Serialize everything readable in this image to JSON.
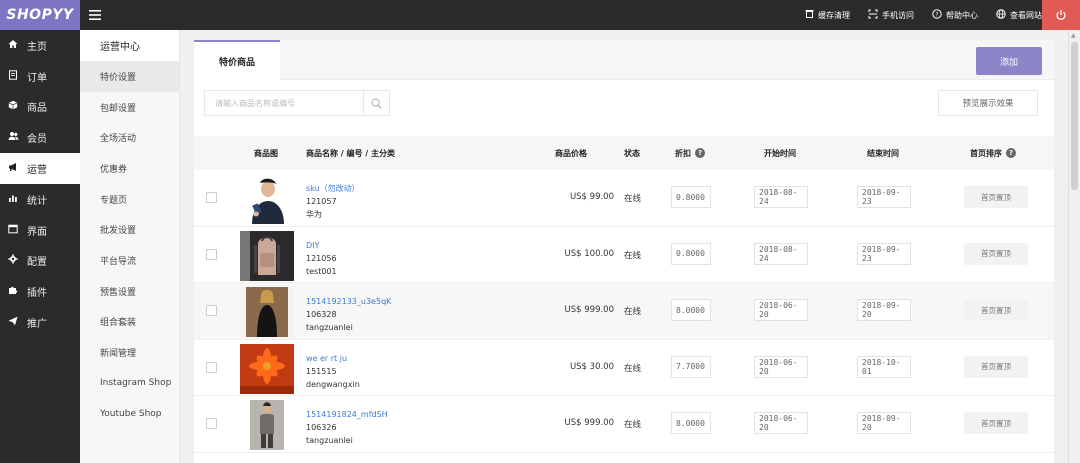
{
  "app": {
    "logo": "SHOPYY"
  },
  "topbar": {
    "actions": [
      {
        "label": "缓存清理",
        "icon": "trash-icon"
      },
      {
        "label": "手机访问",
        "icon": "scan-icon"
      },
      {
        "label": "帮助中心",
        "icon": "help-circle-icon"
      },
      {
        "label": "查看网站",
        "icon": "globe-icon"
      }
    ]
  },
  "sidebar": {
    "items": [
      {
        "label": "主页",
        "icon": "home-icon"
      },
      {
        "label": "订单",
        "icon": "document-icon"
      },
      {
        "label": "商品",
        "icon": "box-icon"
      },
      {
        "label": "会员",
        "icon": "users-icon"
      },
      {
        "label": "运营",
        "icon": "megaphone-icon",
        "active": true
      },
      {
        "label": "统计",
        "icon": "bar-chart-icon"
      },
      {
        "label": "界面",
        "icon": "window-icon"
      },
      {
        "label": "配置",
        "icon": "gear-icon"
      },
      {
        "label": "插件",
        "icon": "puzzle-icon"
      },
      {
        "label": "推广",
        "icon": "send-icon"
      }
    ]
  },
  "subsidebar": {
    "heading": "运营中心",
    "items": [
      {
        "label": "特价设置",
        "active": true
      },
      {
        "label": "包邮设置"
      },
      {
        "label": "全场活动"
      },
      {
        "label": "优惠券"
      },
      {
        "label": "专题页"
      },
      {
        "label": "批发设置"
      },
      {
        "label": "平台导流"
      },
      {
        "label": "预售设置"
      },
      {
        "label": "组合套装"
      },
      {
        "label": "新闻管理"
      },
      {
        "label": "Instagram Shop"
      },
      {
        "label": "Youtube Shop"
      }
    ]
  },
  "main": {
    "tab_label": "特价商品",
    "add_label": "添加",
    "search_placeholder": "请输入商品名称或编号",
    "preview_label": "预览展示效果",
    "columns": {
      "image": "商品图",
      "name": "商品名称 / 编号 / 主分类",
      "price": "商品价格",
      "status": "状态",
      "discount": "折扣",
      "start": "开始时间",
      "end": "结束时间",
      "sort": "首页排序"
    },
    "rows": [
      {
        "name": "sku（勿改动）",
        "code": "121057",
        "category": "华为",
        "price": "US$ 99.00",
        "status": "在线",
        "discount": "0.8000",
        "start": "2018-08-24",
        "end": "2018-09-23",
        "sort_label": "首页置顶",
        "thumb": "person-dark"
      },
      {
        "name": "DIY",
        "code": "121056",
        "category": "test001",
        "price": "US$ 100.00",
        "status": "在线",
        "discount": "0.8000",
        "start": "2018-08-24",
        "end": "2018-09-23",
        "sort_label": "首页置顶",
        "thumb": "backpack"
      },
      {
        "name": "1514192133_u3e5qK",
        "code": "106328",
        "category": "tangzuanlei",
        "price": "US$ 999.00",
        "status": "在线",
        "discount": "8.0000",
        "start": "2018-06-20",
        "end": "2018-09-20",
        "sort_label": "首页置顶",
        "thumb": "woman-black"
      },
      {
        "name": "we er rt ju",
        "code": "151515",
        "category": "dengwangxin",
        "price": "US$ 30.00",
        "status": "在线",
        "discount": "7.7000",
        "start": "2018-06-20",
        "end": "2018-10-01",
        "sort_label": "首页置顶",
        "thumb": "red-flower"
      },
      {
        "name": "1514191824_mfdSH",
        "code": "106326",
        "category": "tangzuanlei",
        "price": "US$ 999.00",
        "status": "在线",
        "discount": "8.0000",
        "start": "2018-06-20",
        "end": "2018-09-20",
        "sort_label": "首页置顶",
        "thumb": "woman-grey"
      }
    ]
  }
}
